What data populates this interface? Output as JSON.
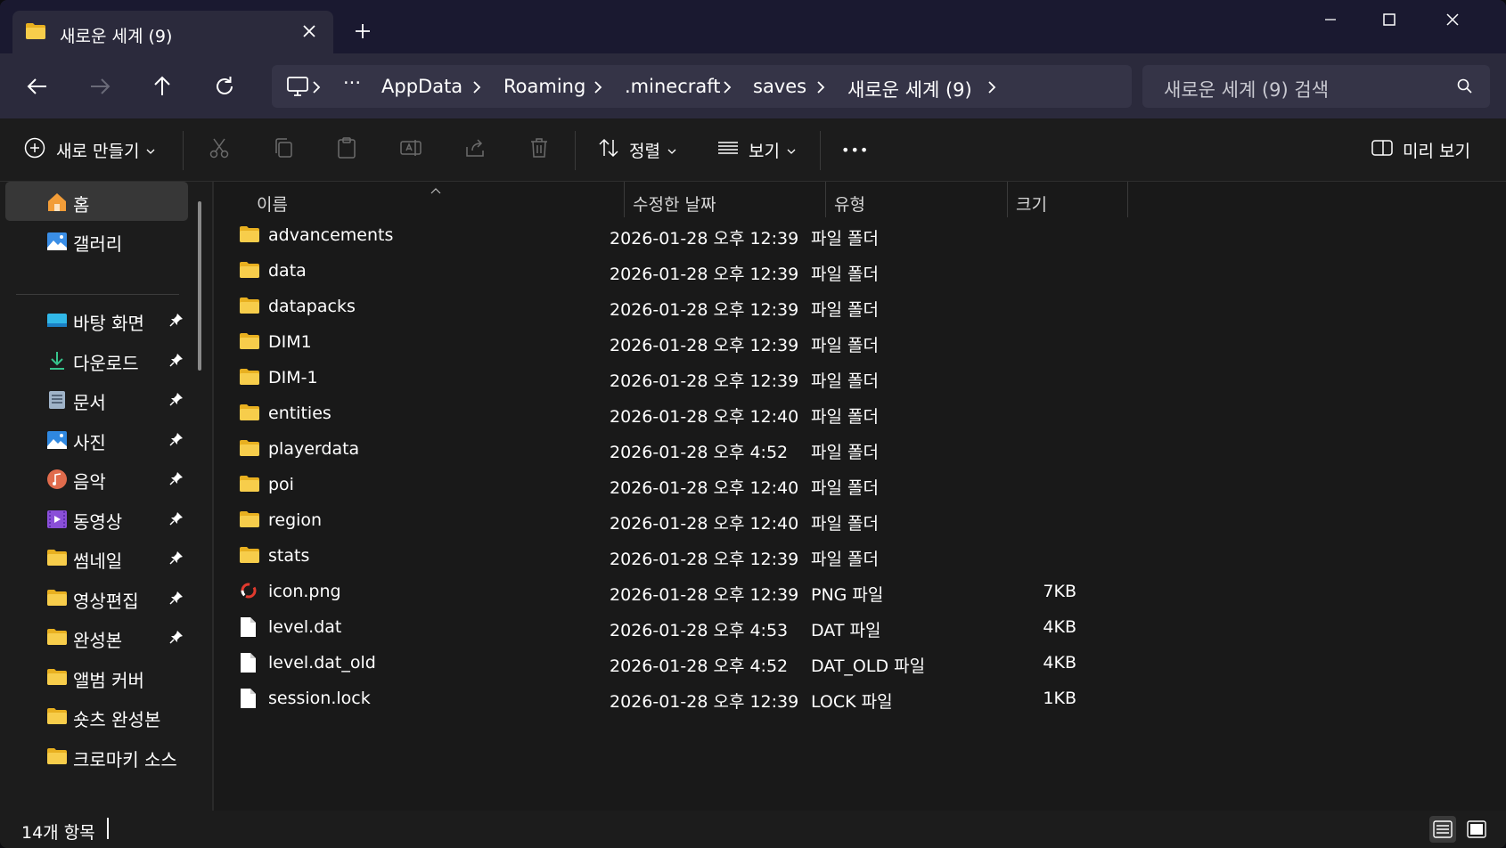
{
  "window": {
    "tab_title": "새로운 세계 (9)",
    "new_tab_symbol": "+"
  },
  "nav": {
    "more_symbol": "···",
    "breadcrumbs": [
      "AppData",
      "Roaming",
      ".minecraft",
      "saves",
      "새로운 세계 (9)"
    ]
  },
  "search": {
    "placeholder": "새로운 세계 (9) 검색"
  },
  "toolbar": {
    "new_label": "새로 만들기",
    "sort_label": "정렬",
    "view_label": "보기",
    "more_symbol": "•••",
    "preview_label": "미리 보기"
  },
  "sidebar": {
    "items": [
      {
        "label": "홈",
        "icon": "home-icon",
        "pinned": false,
        "selected": true
      },
      {
        "label": "갤러리",
        "icon": "gallery-icon",
        "pinned": false
      },
      {
        "label": "바탕 화면",
        "icon": "desktop-icon",
        "pinned": true
      },
      {
        "label": "다운로드",
        "icon": "download-icon",
        "pinned": true
      },
      {
        "label": "문서",
        "icon": "documents-icon",
        "pinned": true
      },
      {
        "label": "사진",
        "icon": "pictures-icon",
        "pinned": true
      },
      {
        "label": "음악",
        "icon": "music-icon",
        "pinned": true
      },
      {
        "label": "동영상",
        "icon": "videos-icon",
        "pinned": true
      },
      {
        "label": "썸네일",
        "icon": "folder-icon",
        "pinned": true
      },
      {
        "label": "영상편집",
        "icon": "folder-icon",
        "pinned": true
      },
      {
        "label": "완성본",
        "icon": "folder-icon",
        "pinned": true
      },
      {
        "label": "앨범 커버",
        "icon": "folder-icon",
        "pinned": false
      },
      {
        "label": "숏츠 완성본",
        "icon": "folder-icon",
        "pinned": false
      },
      {
        "label": "크로마키 소스",
        "icon": "folder-icon",
        "pinned": false
      }
    ]
  },
  "columns": {
    "name": "이름",
    "date": "수정한 날짜",
    "type": "유형",
    "size": "크기"
  },
  "files": [
    {
      "name": "advancements",
      "date": "2026-01-28 오후 12:39",
      "type": "파일 폴더",
      "size": "",
      "kind": "folder"
    },
    {
      "name": "data",
      "date": "2026-01-28 오후 12:39",
      "type": "파일 폴더",
      "size": "",
      "kind": "folder"
    },
    {
      "name": "datapacks",
      "date": "2026-01-28 오후 12:39",
      "type": "파일 폴더",
      "size": "",
      "kind": "folder"
    },
    {
      "name": "DIM1",
      "date": "2026-01-28 오후 12:39",
      "type": "파일 폴더",
      "size": "",
      "kind": "folder"
    },
    {
      "name": "DIM-1",
      "date": "2026-01-28 오후 12:39",
      "type": "파일 폴더",
      "size": "",
      "kind": "folder"
    },
    {
      "name": "entities",
      "date": "2026-01-28 오후 12:40",
      "type": "파일 폴더",
      "size": "",
      "kind": "folder"
    },
    {
      "name": "playerdata",
      "date": "2026-01-28 오후 4:52",
      "type": "파일 폴더",
      "size": "",
      "kind": "folder"
    },
    {
      "name": "poi",
      "date": "2026-01-28 오후 12:40",
      "type": "파일 폴더",
      "size": "",
      "kind": "folder"
    },
    {
      "name": "region",
      "date": "2026-01-28 오후 12:40",
      "type": "파일 폴더",
      "size": "",
      "kind": "folder"
    },
    {
      "name": "stats",
      "date": "2026-01-28 오후 12:39",
      "type": "파일 폴더",
      "size": "",
      "kind": "folder"
    },
    {
      "name": "icon.png",
      "date": "2026-01-28 오후 12:39",
      "type": "PNG 파일",
      "size": "7KB",
      "kind": "image"
    },
    {
      "name": "level.dat",
      "date": "2026-01-28 오후 4:53",
      "type": "DAT 파일",
      "size": "4KB",
      "kind": "file"
    },
    {
      "name": "level.dat_old",
      "date": "2026-01-28 오후 4:52",
      "type": "DAT_OLD 파일",
      "size": "4KB",
      "kind": "file"
    },
    {
      "name": "session.lock",
      "date": "2026-01-28 오후 12:39",
      "type": "LOCK 파일",
      "size": "1KB",
      "kind": "file"
    }
  ],
  "status": {
    "item_count": "14개 항목"
  },
  "colors": {
    "title_bar": "#1a1930",
    "nav_bar": "#2b2a3c",
    "address_bg": "#353447",
    "folder_yellow": "#f5c542",
    "content_bg": "#191919"
  }
}
